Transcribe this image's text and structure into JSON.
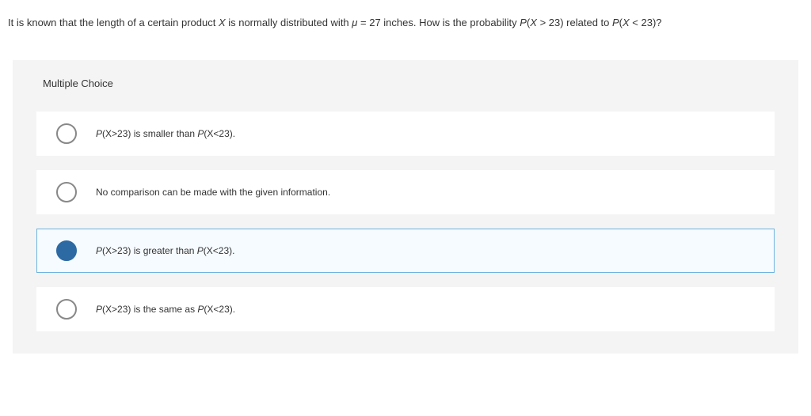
{
  "question": {
    "prefix": "It is known that the length of a certain product ",
    "var1": "X",
    "mid1": " is normally distributed with ",
    "mu": "μ",
    "mid2": " = 27 inches. How is the probability ",
    "p1": "P",
    "p1arg": "(",
    "var2": "X",
    "p1rest": " > 23) related to ",
    "p2": "P",
    "p2arg": "(",
    "var3": "X",
    "p2rest": " < 23)?"
  },
  "mc_label": "Multiple Choice",
  "options": [
    {
      "p1": "P",
      "r1": "(X>23) is smaller than ",
      "p2": "P",
      "r2": "(X<23)."
    },
    {
      "plain": "No comparison can be made with the given information."
    },
    {
      "p1": "P",
      "r1": "(X>23) is greater than ",
      "p2": "P",
      "r2": "(X<23)."
    },
    {
      "p1": "P",
      "r1": "(X>23) is the same as ",
      "p2": "P",
      "r2": "(X<23)."
    }
  ],
  "selected_index": 2
}
